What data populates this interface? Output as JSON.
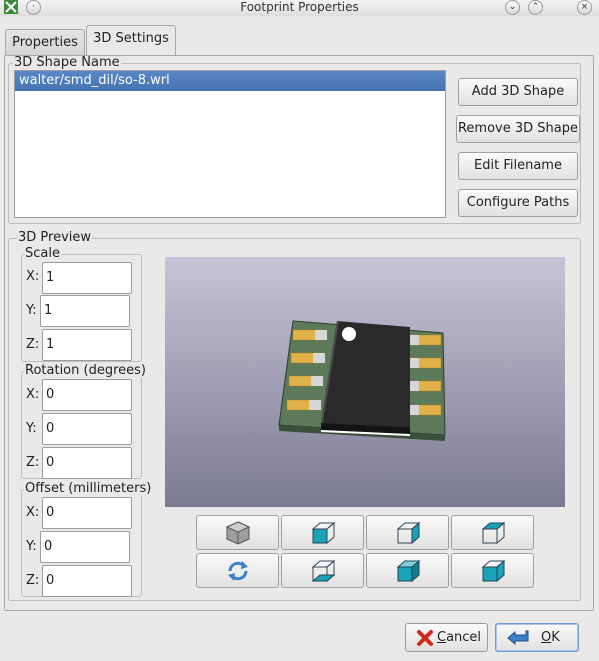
{
  "window": {
    "title": "Footprint Properties"
  },
  "tabs": [
    {
      "label": "Properties"
    },
    {
      "label": "3D Settings"
    }
  ],
  "shape_group": {
    "title": "3D Shape Name",
    "items": [
      "walter/smd_dil/so-8.wrl"
    ],
    "buttons": {
      "add": "Add 3D Shape",
      "remove": "Remove 3D Shape",
      "edit": "Edit Filename",
      "paths": "Configure Paths"
    }
  },
  "preview_group": {
    "title": "3D Preview",
    "scale": {
      "title": "Scale",
      "x_label": "X:",
      "x": "1",
      "y_label": "Y:",
      "y": "1",
      "z_label": "Z:",
      "z": "1"
    },
    "rotation": {
      "title": "Rotation (degrees)",
      "x_label": "X:",
      "x": "0",
      "y_label": "Y:",
      "y": "0",
      "z_label": "Z:",
      "z": "0"
    },
    "offset": {
      "title": "Offset (millimeters)",
      "x_label": "X:",
      "x": "0",
      "y_label": "Y:",
      "y": "0",
      "z_label": "Z:",
      "z": "0"
    },
    "view_buttons": [
      "view-iso-icon",
      "view-front-icon",
      "view-back-icon",
      "view-left-icon",
      "reload-icon",
      "view-right-icon",
      "view-top-icon",
      "view-bottom-icon"
    ]
  },
  "dialog_buttons": {
    "cancel_first": "C",
    "cancel_rest": "ancel",
    "ok_first": "O",
    "ok_rest": "K"
  },
  "colors": {
    "selection": "#4a78b7",
    "preview_top": "#c6c4d6",
    "preview_bottom": "#7b7a93",
    "cube_face": "#1aa3b8"
  }
}
